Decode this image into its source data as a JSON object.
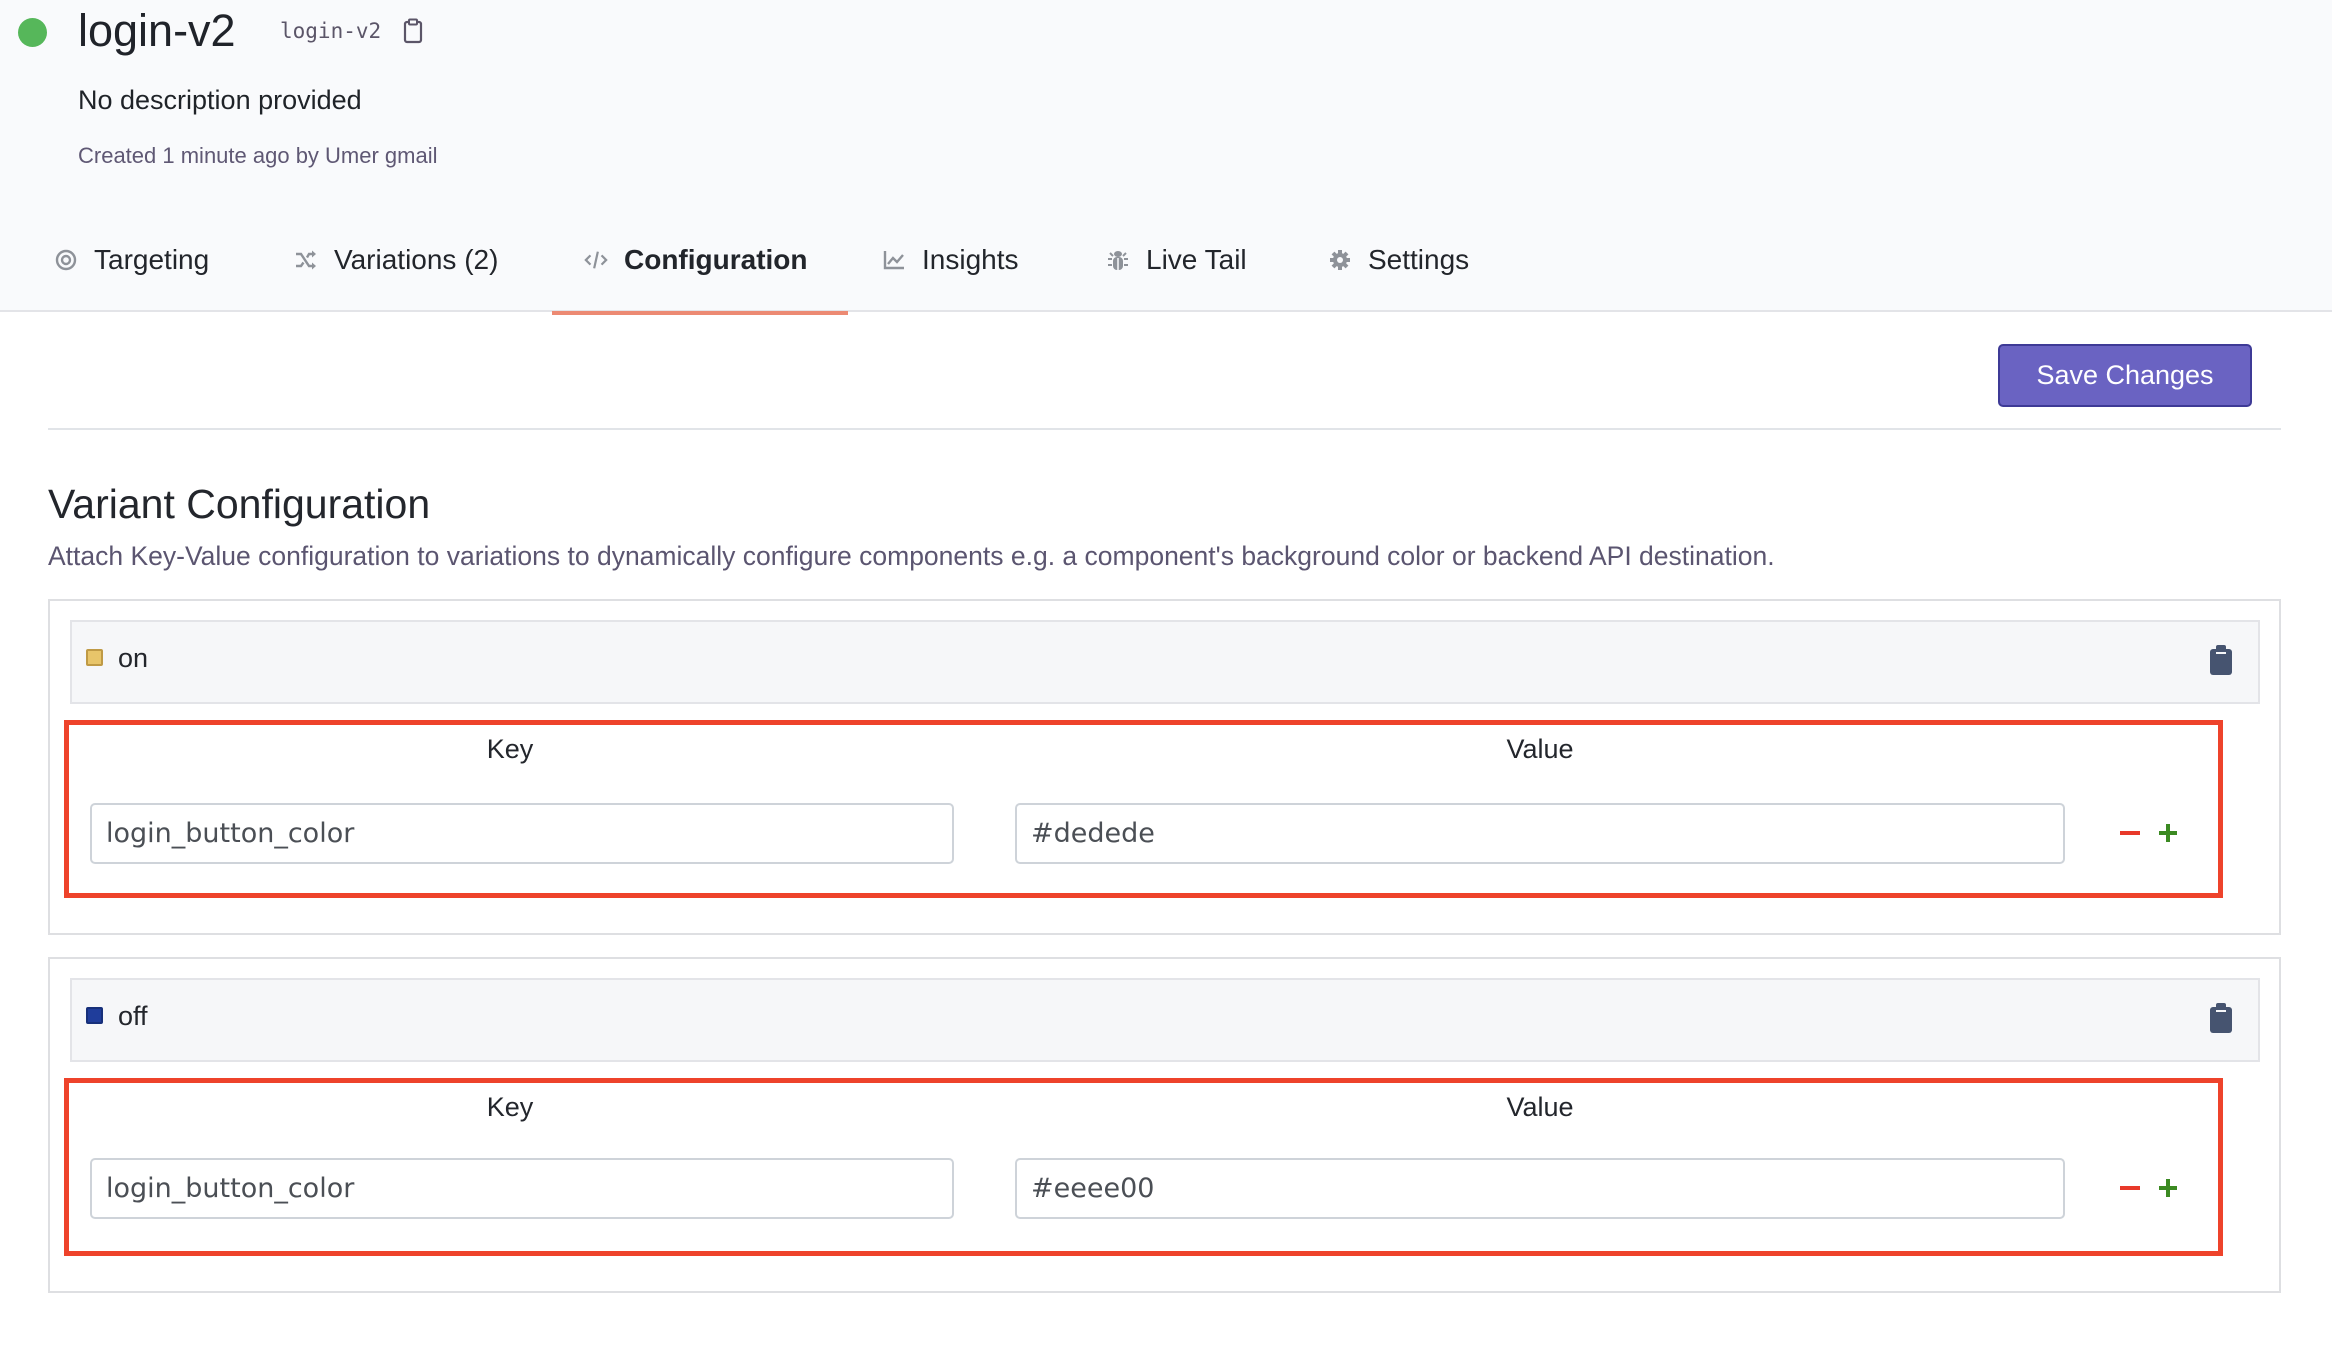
{
  "flag": {
    "status_color": "#56b75a",
    "title": "login-v2",
    "key": "login-v2",
    "copy_icon": "clipboard-icon",
    "description": "No description provided",
    "created": "Created 1 minute ago by Umer gmail"
  },
  "tabs": [
    {
      "label": "Targeting",
      "icon": "target-icon",
      "active": false
    },
    {
      "label": "Variations (2)",
      "icon": "shuffle-icon",
      "active": false
    },
    {
      "label": "Configuration",
      "icon": "code-icon",
      "active": true
    },
    {
      "label": "Insights",
      "icon": "chart-line-icon",
      "active": false
    },
    {
      "label": "Live Tail",
      "icon": "bug-icon",
      "active": false
    },
    {
      "label": "Settings",
      "icon": "gear-icon",
      "active": false
    }
  ],
  "toolbar": {
    "save_label": "Save Changes"
  },
  "section": {
    "title": "Variant Configuration",
    "description": "Attach Key-Value configuration to variations to dynamically configure components e.g. a component's background color or backend API destination."
  },
  "variants": [
    {
      "name": "on",
      "swatch_color": "#e8c56a",
      "swatch_border": "#bf9a45",
      "key_label": "Key",
      "value_label": "Value",
      "pairs": [
        {
          "key": "login_button_color",
          "value": "#dedede"
        }
      ]
    },
    {
      "name": "off",
      "swatch_color": "#1f3d9b",
      "swatch_border": "#17307a",
      "key_label": "Key",
      "value_label": "Value",
      "pairs": [
        {
          "key": "login_button_color",
          "value": "#eeee00"
        }
      ]
    }
  ],
  "colors": {
    "accent": "#6a63c2",
    "active_tab_underline": "#ec8a73",
    "highlight_box": "#ee432b",
    "remove": "#e8392a",
    "add": "#3b8a22"
  }
}
